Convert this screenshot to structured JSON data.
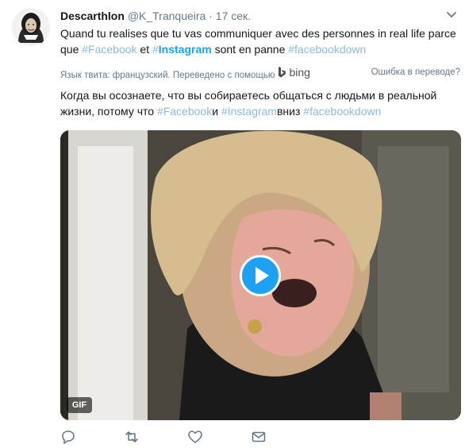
{
  "author": {
    "name": "Descarthlon",
    "handle": "@K_Tranqueira",
    "separator": "·",
    "time": "17 сек."
  },
  "tweet_fr": {
    "part1": "Quand tu realises que tu vas communiquer avec des personnes in real life parce que ",
    "tag_facebook": "#Facebook",
    "part2": " et ",
    "tag_instagram_hash": "#",
    "tag_instagram_word": "Instagram",
    "part3": " sont en panne ",
    "tag_facebookdown": "#facebookdown"
  },
  "translation_bar": {
    "label": "Язык твита: французский. Переведено с помощью",
    "provider": "bing",
    "error_link": "Ошибка в переводе?"
  },
  "tweet_ru": {
    "part1": "Когда вы осознаете, что вы собираетесь общаться с людьми в реальной жизни, потому что ",
    "tag_facebook": "#Facebook",
    "part2": "и ",
    "tag_instagram": "#Instagram",
    "part3": "вниз ",
    "tag_facebookdown": "#facebookdown"
  },
  "media": {
    "badge": "GIF",
    "play_icon": "play-icon"
  },
  "actions": {
    "icons": [
      "reply-icon",
      "retweet-icon",
      "like-icon",
      "direct-message-icon"
    ]
  },
  "colors": {
    "link": "#1da1f2",
    "link_dim": "#8bbad8",
    "muted": "#657786",
    "text": "#14171a",
    "action_icon": "#657786"
  }
}
